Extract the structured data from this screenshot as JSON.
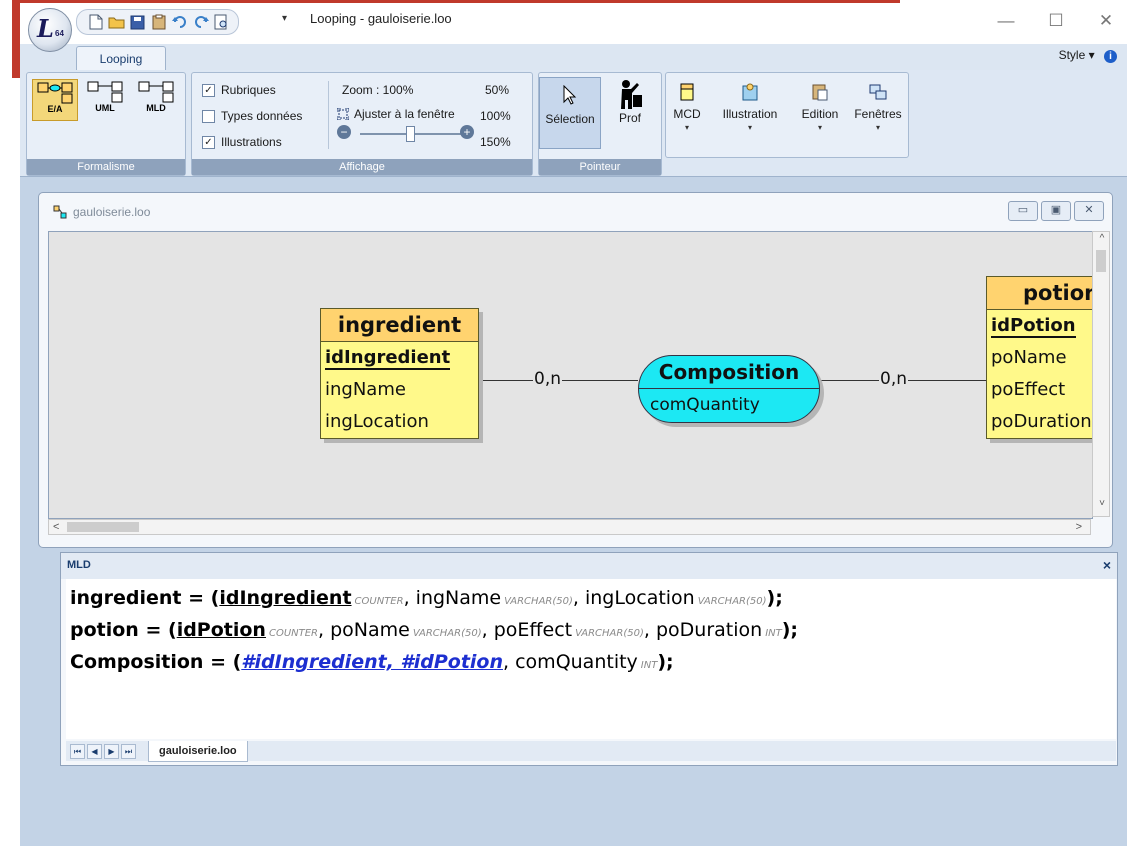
{
  "window": {
    "title": "Looping - gauloiserie.loo",
    "logo_text": "L",
    "logo_badge": "64",
    "controls": [
      "—",
      "☐",
      "✕"
    ]
  },
  "quick_access": {
    "icons": [
      "new-file-icon",
      "open-folder-icon",
      "save-icon",
      "paste-icon",
      "undo-icon",
      "redo-icon",
      "print-preview-icon"
    ],
    "more": "▾"
  },
  "ribbon": {
    "tab": "Looping",
    "style_label": "Style",
    "style_arrow": "▾",
    "info": "i",
    "groups": {
      "formalisme": {
        "label": "Formalisme",
        "buttons": [
          {
            "label": "E/A",
            "selected": true
          },
          {
            "label": "UML",
            "selected": false
          },
          {
            "label": "MLD",
            "selected": false
          }
        ]
      },
      "affichage": {
        "label": "Affichage",
        "checkboxes": [
          {
            "label": "Rubriques",
            "checked": true
          },
          {
            "label": "Types données",
            "checked": false
          },
          {
            "label": "Illustrations",
            "checked": true
          }
        ],
        "zoom_label": "Zoom : 100%",
        "fit_label": "Ajuster à la fenêtre",
        "presets": [
          "50%",
          "100%",
          "150%"
        ],
        "zoom_minus": "−",
        "zoom_plus": "+",
        "zoom_level": 1.0
      },
      "pointeur": {
        "label": "Pointeur",
        "buttons": [
          {
            "label": "Sélection",
            "icon": "arrow-pointer-icon",
            "selected": true
          },
          {
            "label": "Prof",
            "icon": "teacher-icon",
            "selected": false
          }
        ]
      },
      "menus": [
        {
          "label": "MCD",
          "icon": "mcd-entity-icon"
        },
        {
          "label": "Illustration",
          "icon": "illustration-icon"
        },
        {
          "label": "Edition",
          "icon": "clipboard-icon"
        },
        {
          "label": "Fenêtres",
          "icon": "windows-icon"
        }
      ],
      "dropdown_arrow": "▾"
    }
  },
  "document": {
    "title": "gauloiserie.loo",
    "controls": [
      "▭",
      "▣",
      "✕"
    ],
    "scroll": {
      "up": "^",
      "down": "˅",
      "left": "<",
      "right": ">"
    }
  },
  "diagram": {
    "entities": [
      {
        "name": "ingredient",
        "key": "idIngredient",
        "attributes": [
          "ingName",
          "ingLocation"
        ]
      },
      {
        "name": "potion",
        "key": "idPotion",
        "attributes": [
          "poName",
          "poEffect",
          "poDuration"
        ]
      }
    ],
    "association": {
      "name": "Composition",
      "attribute": "comQuantity"
    },
    "cardinalities": [
      "0,n",
      "0,n"
    ]
  },
  "mld": {
    "title": "MLD",
    "close": "×",
    "relations": [
      {
        "name": "ingredient",
        "open": " = (",
        "close": ");",
        "pk": "idIngredient",
        "pk_type": "COUNTER",
        "fields": [
          {
            "name": "ingName",
            "type": "VARCHAR(50)"
          },
          {
            "name": "ingLocation",
            "type": "VARCHAR(50)"
          }
        ]
      },
      {
        "name": "potion",
        "open": " = (",
        "close": ");",
        "pk": "idPotion",
        "pk_type": "COUNTER",
        "fields": [
          {
            "name": "poName",
            "type": "VARCHAR(50)"
          },
          {
            "name": "poEffect",
            "type": "VARCHAR(50)"
          },
          {
            "name": "poDuration",
            "type": "INT"
          }
        ]
      },
      {
        "name": "Composition",
        "open": " = (",
        "close": ");",
        "fk": "#idIngredient, #idPotion",
        "fields": [
          {
            "name": "comQuantity",
            "type": "INT"
          }
        ]
      }
    ],
    "separator": ", ",
    "nav": [
      "⏮",
      "◀",
      "▶",
      "⏭"
    ],
    "sheet": "gauloiserie.loo"
  },
  "colors": {
    "entity_fill": "#fff98a",
    "entity_header": "#ffd36f",
    "association_fill": "#1ce8f3",
    "foreign_key": "#1d2fd0",
    "workspace": "#c3d3e6"
  }
}
